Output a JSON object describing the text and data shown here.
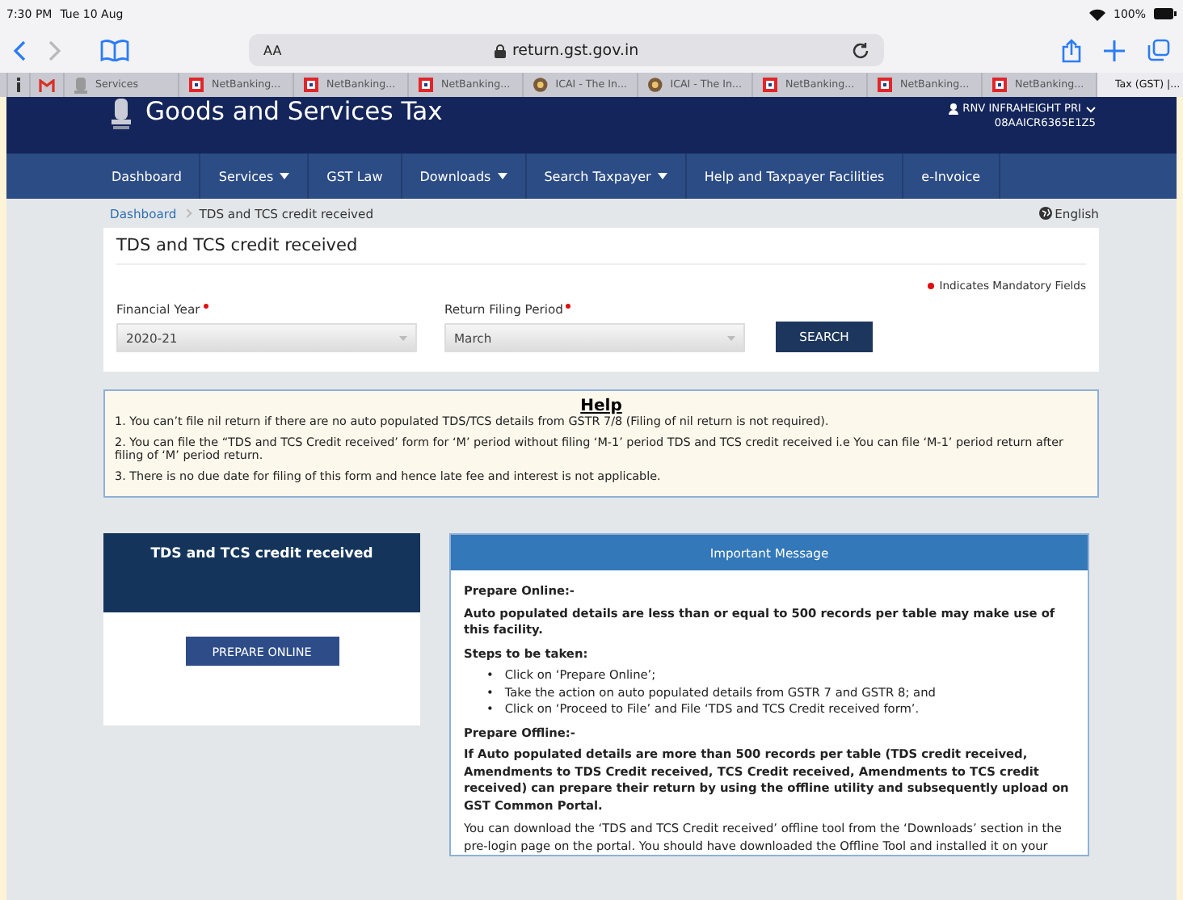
{
  "status_bar": {
    "time": "7:30 PM",
    "date": "Tue 10 Aug",
    "battery": "100%"
  },
  "browser": {
    "text_size": "AA",
    "address": "return.gst.gov.in"
  },
  "tabs": [
    {
      "kind": "info",
      "selected": false
    },
    {
      "kind": "mail",
      "selected": false
    },
    {
      "label": "Services",
      "kind": "emblem",
      "selected": false
    },
    {
      "label": "NetBanking...",
      "kind": "bank",
      "selected": false
    },
    {
      "label": "NetBanking...",
      "kind": "bank",
      "selected": false
    },
    {
      "label": "NetBanking...",
      "kind": "bank",
      "selected": false
    },
    {
      "label": "ICAI - The In...",
      "kind": "seal",
      "selected": false
    },
    {
      "label": "ICAI - The In...",
      "kind": "seal",
      "selected": false
    },
    {
      "label": "NetBanking...",
      "kind": "bank",
      "selected": false
    },
    {
      "label": "NetBanking...",
      "kind": "bank",
      "selected": false
    },
    {
      "label": "NetBanking...",
      "kind": "bank",
      "selected": false
    },
    {
      "label": "Tax (GST) |...",
      "kind": "close",
      "selected": true
    }
  ],
  "header": {
    "title": "Goods and Services Tax",
    "user": "RNV INFRAHEIGHT PRI",
    "gstin": "08AAICR6365E1Z5"
  },
  "nav": [
    {
      "label": "Dashboard",
      "dropdown": false
    },
    {
      "label": "Services",
      "dropdown": true
    },
    {
      "label": "GST Law",
      "dropdown": false
    },
    {
      "label": "Downloads",
      "dropdown": true
    },
    {
      "label": "Search Taxpayer",
      "dropdown": true
    },
    {
      "label": "Help and Taxpayer Facilities",
      "dropdown": false
    },
    {
      "label": "e-Invoice",
      "dropdown": false
    }
  ],
  "breadcrumb": {
    "link": "Dashboard",
    "current": "TDS and TCS credit received",
    "language": "English"
  },
  "form": {
    "title": "TDS and TCS credit received",
    "mandatory_note": "Indicates Mandatory Fields",
    "fields": [
      {
        "label": "Financial Year",
        "value": "2020-21"
      },
      {
        "label": "Return Filing Period",
        "value": "March"
      }
    ],
    "button": "SEARCH"
  },
  "help": {
    "title": "Help",
    "items": [
      "1. You can’t file nil return if there are no auto populated TDS/TCS details from GSTR 7/8 (Filing of nil return is not required).",
      "2. You can file the “TDS and TCS Credit received’ form for ‘M’ period without filing ‘M-1’ period TDS and TCS credit received i.e You can file ‘M-1’ period return after filing of ‘M’ period return.",
      "3. There is no due date for filing of this form and hence late fee and interest is not applicable."
    ]
  },
  "panel": {
    "title": "TDS and TCS credit received",
    "button": "PREPARE ONLINE"
  },
  "message": {
    "title": "Important Message",
    "blocks": [
      {
        "kind": "heading",
        "text": "Prepare Online:-"
      },
      {
        "kind": "bold",
        "text": "Auto populated details are less than or equal to 500 records per table may make use of this facility."
      },
      {
        "kind": "heading",
        "text": "Steps to be taken:"
      },
      {
        "kind": "list",
        "marker": "•",
        "items": [
          "Click on ‘Prepare Online’;",
          "Take the action on auto populated details from GSTR 7 and GSTR 8; and",
          "Click on ‘Proceed to File’ and File ‘TDS and TCS Credit received form’."
        ]
      },
      {
        "kind": "heading",
        "text": "Prepare Offline:-"
      },
      {
        "kind": "bold",
        "text": "If Auto populated details are more than 500 records per table (TDS credit received, Amendments to TDS Credit received, TCS Credit received, Amendments to TCS credit received) can prepare their return by using the offline utility and subsequently upload on GST Common Portal."
      },
      {
        "kind": "para",
        "text": "You can download the ‘TDS and TCS Credit received’ offline tool from the ‘Downloads’ section in the pre-login page on the portal. You should have downloaded the Offline Tool and installed it on your"
      }
    ]
  }
}
